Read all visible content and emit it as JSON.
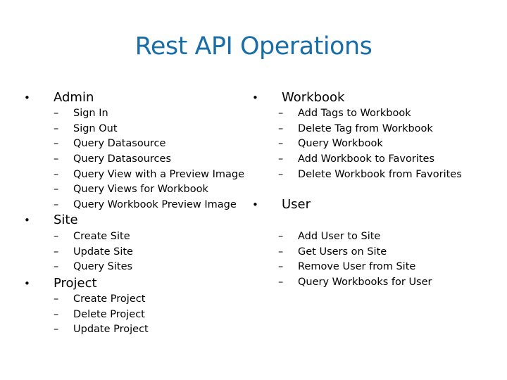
{
  "title": "Rest API Operations",
  "left": [
    {
      "label": "Admin",
      "items": [
        "Sign In",
        "Sign Out",
        "Query Datasource",
        "Query Datasources",
        "Query View with a Preview Image",
        "Query Views for Workbook",
        "Query Workbook Preview Image"
      ]
    },
    {
      "label": "Site",
      "items": [
        "Create Site",
        "Update Site",
        "Query Sites"
      ]
    },
    {
      "label": "Project",
      "items": [
        "Create Project",
        "Delete Project",
        "Update Project"
      ]
    }
  ],
  "right": [
    {
      "label": "Workbook",
      "items": [
        "Add Tags to Workbook",
        "Delete Tag from Workbook",
        "Query Workbook",
        "Add Workbook to Favorites",
        "Delete Workbook from Favorites"
      ]
    },
    {
      "label": "User",
      "items": [
        "Add User to Site",
        "Get Users on Site",
        "Remove User from Site",
        "Query Workbooks for User"
      ]
    }
  ],
  "glyphs": {
    "bullet": "•",
    "dash": "–"
  }
}
